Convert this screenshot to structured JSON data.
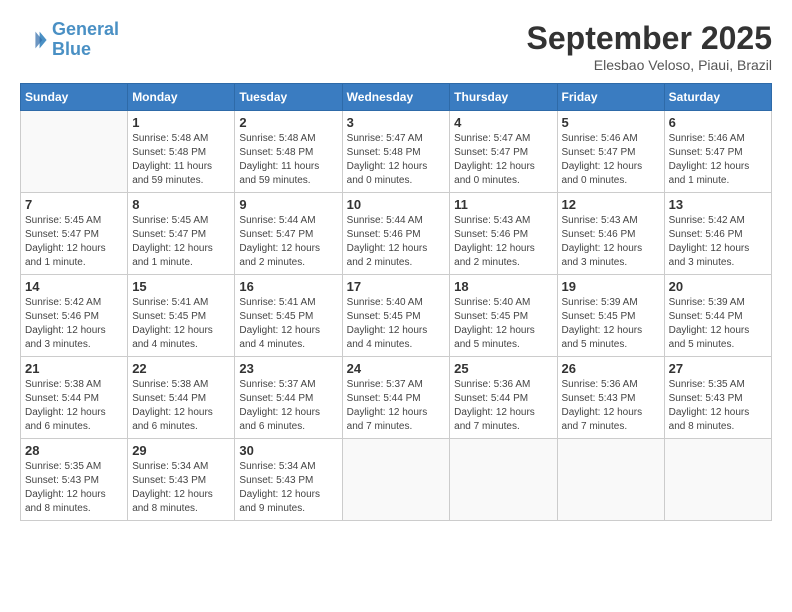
{
  "logo": {
    "line1": "General",
    "line2": "Blue"
  },
  "header": {
    "month": "September 2025",
    "location": "Elesbao Veloso, Piaui, Brazil"
  },
  "weekdays": [
    "Sunday",
    "Monday",
    "Tuesday",
    "Wednesday",
    "Thursday",
    "Friday",
    "Saturday"
  ],
  "weeks": [
    [
      {
        "day": "",
        "info": ""
      },
      {
        "day": "1",
        "info": "Sunrise: 5:48 AM\nSunset: 5:48 PM\nDaylight: 11 hours\nand 59 minutes."
      },
      {
        "day": "2",
        "info": "Sunrise: 5:48 AM\nSunset: 5:48 PM\nDaylight: 11 hours\nand 59 minutes."
      },
      {
        "day": "3",
        "info": "Sunrise: 5:47 AM\nSunset: 5:48 PM\nDaylight: 12 hours\nand 0 minutes."
      },
      {
        "day": "4",
        "info": "Sunrise: 5:47 AM\nSunset: 5:47 PM\nDaylight: 12 hours\nand 0 minutes."
      },
      {
        "day": "5",
        "info": "Sunrise: 5:46 AM\nSunset: 5:47 PM\nDaylight: 12 hours\nand 0 minutes."
      },
      {
        "day": "6",
        "info": "Sunrise: 5:46 AM\nSunset: 5:47 PM\nDaylight: 12 hours\nand 1 minute."
      }
    ],
    [
      {
        "day": "7",
        "info": "Sunrise: 5:45 AM\nSunset: 5:47 PM\nDaylight: 12 hours\nand 1 minute."
      },
      {
        "day": "8",
        "info": "Sunrise: 5:45 AM\nSunset: 5:47 PM\nDaylight: 12 hours\nand 1 minute."
      },
      {
        "day": "9",
        "info": "Sunrise: 5:44 AM\nSunset: 5:47 PM\nDaylight: 12 hours\nand 2 minutes."
      },
      {
        "day": "10",
        "info": "Sunrise: 5:44 AM\nSunset: 5:46 PM\nDaylight: 12 hours\nand 2 minutes."
      },
      {
        "day": "11",
        "info": "Sunrise: 5:43 AM\nSunset: 5:46 PM\nDaylight: 12 hours\nand 2 minutes."
      },
      {
        "day": "12",
        "info": "Sunrise: 5:43 AM\nSunset: 5:46 PM\nDaylight: 12 hours\nand 3 minutes."
      },
      {
        "day": "13",
        "info": "Sunrise: 5:42 AM\nSunset: 5:46 PM\nDaylight: 12 hours\nand 3 minutes."
      }
    ],
    [
      {
        "day": "14",
        "info": "Sunrise: 5:42 AM\nSunset: 5:46 PM\nDaylight: 12 hours\nand 3 minutes."
      },
      {
        "day": "15",
        "info": "Sunrise: 5:41 AM\nSunset: 5:45 PM\nDaylight: 12 hours\nand 4 minutes."
      },
      {
        "day": "16",
        "info": "Sunrise: 5:41 AM\nSunset: 5:45 PM\nDaylight: 12 hours\nand 4 minutes."
      },
      {
        "day": "17",
        "info": "Sunrise: 5:40 AM\nSunset: 5:45 PM\nDaylight: 12 hours\nand 4 minutes."
      },
      {
        "day": "18",
        "info": "Sunrise: 5:40 AM\nSunset: 5:45 PM\nDaylight: 12 hours\nand 5 minutes."
      },
      {
        "day": "19",
        "info": "Sunrise: 5:39 AM\nSunset: 5:45 PM\nDaylight: 12 hours\nand 5 minutes."
      },
      {
        "day": "20",
        "info": "Sunrise: 5:39 AM\nSunset: 5:44 PM\nDaylight: 12 hours\nand 5 minutes."
      }
    ],
    [
      {
        "day": "21",
        "info": "Sunrise: 5:38 AM\nSunset: 5:44 PM\nDaylight: 12 hours\nand 6 minutes."
      },
      {
        "day": "22",
        "info": "Sunrise: 5:38 AM\nSunset: 5:44 PM\nDaylight: 12 hours\nand 6 minutes."
      },
      {
        "day": "23",
        "info": "Sunrise: 5:37 AM\nSunset: 5:44 PM\nDaylight: 12 hours\nand 6 minutes."
      },
      {
        "day": "24",
        "info": "Sunrise: 5:37 AM\nSunset: 5:44 PM\nDaylight: 12 hours\nand 7 minutes."
      },
      {
        "day": "25",
        "info": "Sunrise: 5:36 AM\nSunset: 5:44 PM\nDaylight: 12 hours\nand 7 minutes."
      },
      {
        "day": "26",
        "info": "Sunrise: 5:36 AM\nSunset: 5:43 PM\nDaylight: 12 hours\nand 7 minutes."
      },
      {
        "day": "27",
        "info": "Sunrise: 5:35 AM\nSunset: 5:43 PM\nDaylight: 12 hours\nand 8 minutes."
      }
    ],
    [
      {
        "day": "28",
        "info": "Sunrise: 5:35 AM\nSunset: 5:43 PM\nDaylight: 12 hours\nand 8 minutes."
      },
      {
        "day": "29",
        "info": "Sunrise: 5:34 AM\nSunset: 5:43 PM\nDaylight: 12 hours\nand 8 minutes."
      },
      {
        "day": "30",
        "info": "Sunrise: 5:34 AM\nSunset: 5:43 PM\nDaylight: 12 hours\nand 9 minutes."
      },
      {
        "day": "",
        "info": ""
      },
      {
        "day": "",
        "info": ""
      },
      {
        "day": "",
        "info": ""
      },
      {
        "day": "",
        "info": ""
      }
    ]
  ]
}
